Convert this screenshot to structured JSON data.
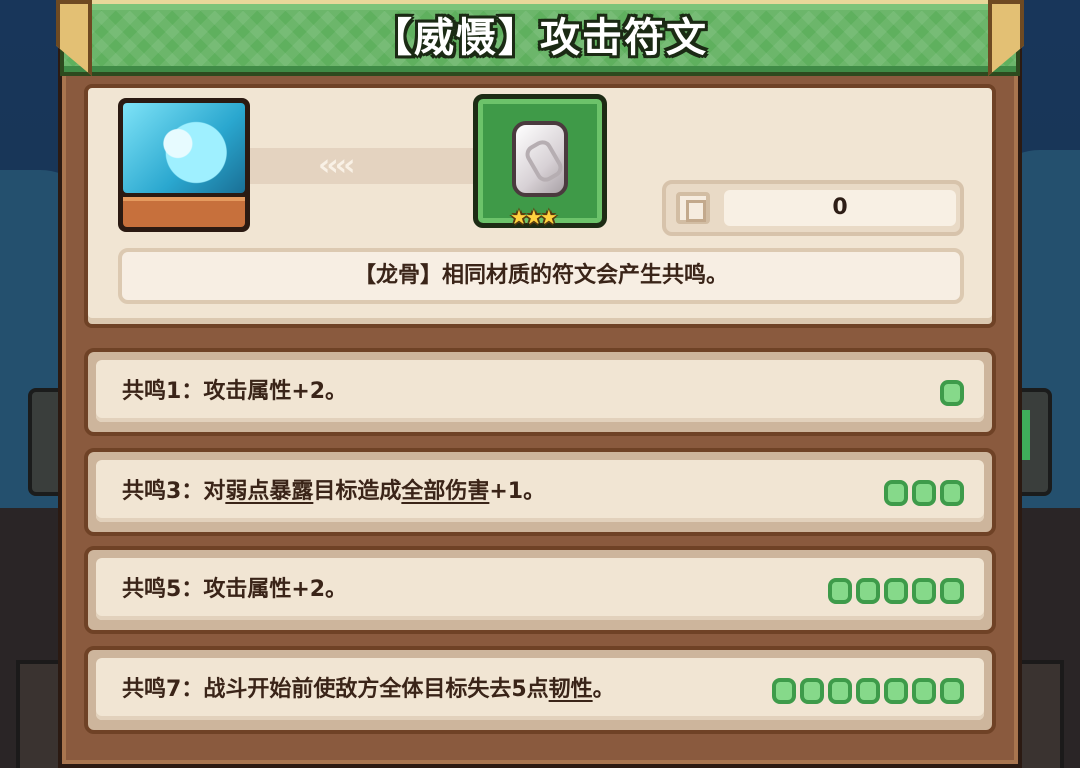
{
  "title": "【威慑】攻击符文",
  "character": {
    "portrait_icon": "ice-spirit-portrait"
  },
  "rune": {
    "icon": "bone-rune-stone",
    "stars_display": "★★★",
    "star_count": 3
  },
  "transfer_arrows": "‹‹‹‹",
  "count": {
    "icon": "rune-bag-icon",
    "value": "0"
  },
  "description": "【龙骨】相同材质的符文会产生共鸣。",
  "resonances": [
    {
      "prefix": "共鸣1：",
      "parts": [
        {
          "text": "攻击属性+2。",
          "link": false
        }
      ],
      "pips": 1
    },
    {
      "prefix": "共鸣3：",
      "parts": [
        {
          "text": "对",
          "link": false
        },
        {
          "text": "弱点暴露",
          "link": true
        },
        {
          "text": "目标造成",
          "link": false
        },
        {
          "text": "全部伤害",
          "link": true
        },
        {
          "text": "+1。",
          "link": false
        }
      ],
      "pips": 3
    },
    {
      "prefix": "共鸣5：",
      "parts": [
        {
          "text": "攻击属性+2。",
          "link": false
        }
      ],
      "pips": 5
    },
    {
      "prefix": "共鸣7：",
      "parts": [
        {
          "text": "战斗开始前使敌方全体目标失去5点",
          "link": false
        },
        {
          "text": "韧性",
          "link": true
        },
        {
          "text": "。",
          "link": false
        }
      ],
      "pips": 7
    }
  ],
  "colors": {
    "pip_fill": "#86d98a",
    "pip_border": "#3e9b4a",
    "banner_green": "#5fb05e",
    "panel_brown": "#8a5a3e"
  }
}
